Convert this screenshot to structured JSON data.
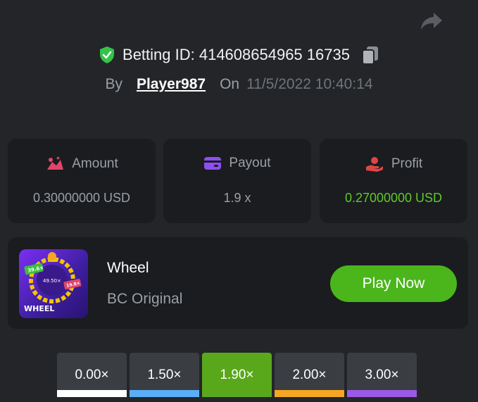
{
  "header": {
    "betting_id_label": "Betting ID: 414608654965 16735",
    "by_label": "By",
    "player": "Player987",
    "on_label": "On",
    "datetime": "11/5/2022 10:40:14"
  },
  "stats": {
    "amount": {
      "label": "Amount",
      "value": "0.30000000 USD",
      "icon": "amount-icon"
    },
    "payout": {
      "label": "Payout",
      "value": "1.9 x",
      "icon": "wallet-icon"
    },
    "profit": {
      "label": "Profit",
      "value": "0.27000000 USD",
      "icon": "hand-coin-icon",
      "color": "#5fc92b"
    }
  },
  "game": {
    "name": "Wheel",
    "provider": "BC Original",
    "thumb_label": "WHEEL",
    "thumb_tags": [
      "39.6×",
      "49.50×",
      "19.8×"
    ],
    "play_label": "Play Now",
    "play_color": "#4bb51c"
  },
  "multipliers": [
    {
      "label": "0.00×",
      "color": "#ffffff",
      "active": false
    },
    {
      "label": "1.50×",
      "color": "#5aaef7",
      "active": false
    },
    {
      "label": "1.90×",
      "color": "#59a81c",
      "active": true
    },
    {
      "label": "2.00×",
      "color": "#f5a623",
      "active": false
    },
    {
      "label": "3.00×",
      "color": "#9b59e6",
      "active": false
    }
  ]
}
